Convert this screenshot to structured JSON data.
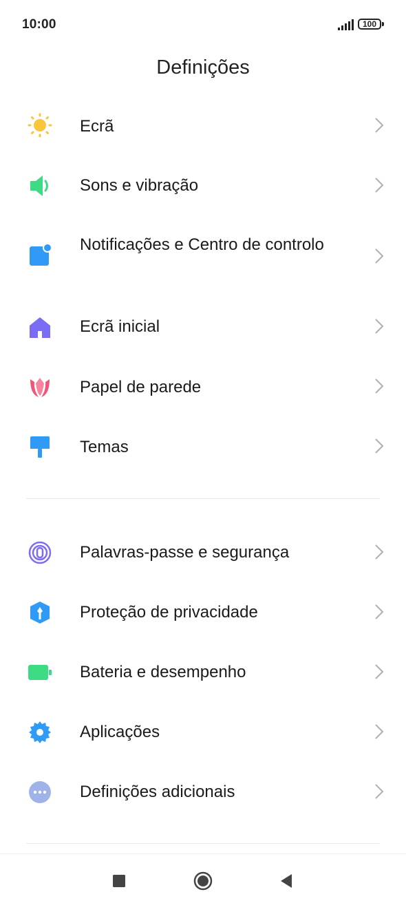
{
  "status_bar": {
    "time": "10:00",
    "battery": "100",
    "signal_icon": "signal-bars-icon"
  },
  "header": {
    "title": "Definições"
  },
  "sections": [
    {
      "items": [
        {
          "label": "Ecrã",
          "icon": "sun-icon",
          "color": "#F9C53B"
        },
        {
          "label": "Sons e vibração",
          "icon": "speaker-icon",
          "color": "#3DDC84"
        },
        {
          "label": "Notificações e Centro de controlo",
          "icon": "notification-icon",
          "color": "#2F9BF6"
        },
        {
          "label": "Ecrã inicial",
          "icon": "home-icon",
          "color": "#7B6CF6"
        },
        {
          "label": "Papel de parede",
          "icon": "tulip-icon",
          "color": "#F2557A"
        },
        {
          "label": "Temas",
          "icon": "paintbrush-icon",
          "color": "#2F9BF6"
        }
      ]
    },
    {
      "items": [
        {
          "label": "Palavras-passe e segurança",
          "icon": "fingerprint-icon",
          "color": "#7B6CF6"
        },
        {
          "label": "Proteção de privacidade",
          "icon": "shield-icon",
          "color": "#2F9BF6"
        },
        {
          "label": "Bateria e desempenho",
          "icon": "battery-icon",
          "color": "#3DDC84"
        },
        {
          "label": "Aplicações",
          "icon": "gear-icon",
          "color": "#2F9BF6"
        },
        {
          "label": "Definições adicionais",
          "icon": "more-icon",
          "color": "#9FB3E8"
        }
      ]
    }
  ],
  "nav_bar": {
    "recents_icon": "square-icon",
    "home_icon": "circle-icon",
    "back_icon": "back-triangle-icon"
  }
}
